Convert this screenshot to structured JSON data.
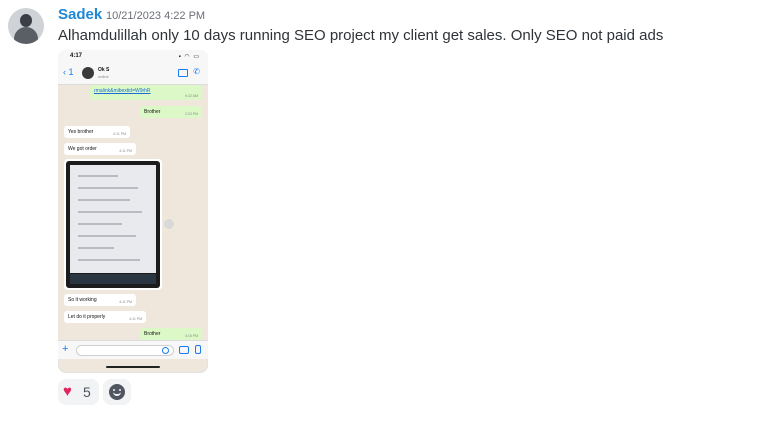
{
  "message": {
    "author": "Sadek",
    "timestamp": "10/21/2023 4:22 PM",
    "content": "Alhamdulillah only 10 days running SEO project my client get sales. Only SEO not paid ads"
  },
  "attachment": {
    "phone_time": "4:17",
    "contact_name": "Ok S",
    "contact_status": "online",
    "messages": [
      {
        "text": "rmalink&mibextid=W9rhR",
        "time": "9:22 AM",
        "dir": "out"
      },
      {
        "text": "Brother",
        "time": "2:23 PM",
        "dir": "out"
      },
      {
        "text": "Yes brother",
        "time": "4:11 PM",
        "dir": "in"
      },
      {
        "text": "We got order",
        "time": "4:11 PM",
        "dir": "in"
      },
      {
        "text": "So it working",
        "time": "4:11 PM",
        "dir": "in"
      },
      {
        "text": "Let do it properly",
        "time": "4:11 PM",
        "dir": "in"
      },
      {
        "text": "Brother",
        "time": "4:16 PM",
        "dir": "out"
      }
    ],
    "image_time": "4:11 PM"
  },
  "reactions": [
    {
      "emoji": "heart",
      "count": "5"
    }
  ],
  "colors": {
    "author": "#1e88d6",
    "heart": "#e0245e",
    "outgoing_bubble": "#dcf8c6"
  }
}
